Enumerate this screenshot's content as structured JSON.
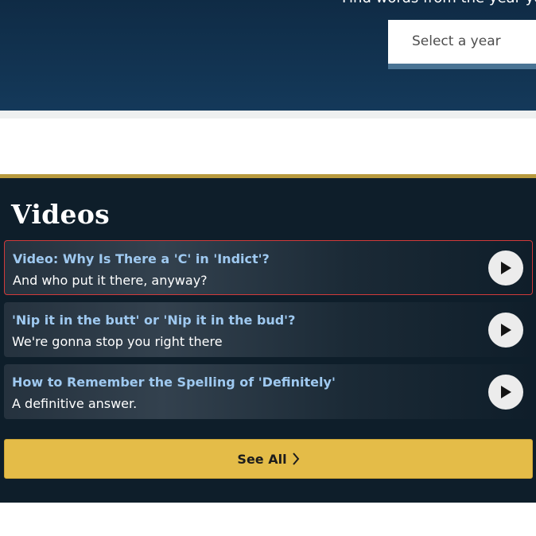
{
  "year_finder": {
    "caption": "Find words from the year you",
    "select_placeholder": "Select a year"
  },
  "videos": {
    "heading": "Videos",
    "items": [
      {
        "title": "Video: Why Is There a 'C' in 'Indict'?",
        "subtitle": "And who put it there, anyway?",
        "active": true
      },
      {
        "title": "'Nip it in the butt' or 'Nip it in the bud'?",
        "subtitle": "We're gonna stop you right there",
        "active": false
      },
      {
        "title": "How to Remember the Spelling of 'Definitely'",
        "subtitle": "A definitive answer.",
        "active": false
      }
    ],
    "see_all_label": "See All"
  },
  "icons": {
    "play": "play-icon",
    "chevron": "chevron-right-icon"
  },
  "colors": {
    "header_bg": "#14395a",
    "videos_bg": "#0e1e2a",
    "accent_gold": "#e4bc48",
    "title_blue": "#9fc9f0",
    "active_outline": "#d13a3a"
  }
}
